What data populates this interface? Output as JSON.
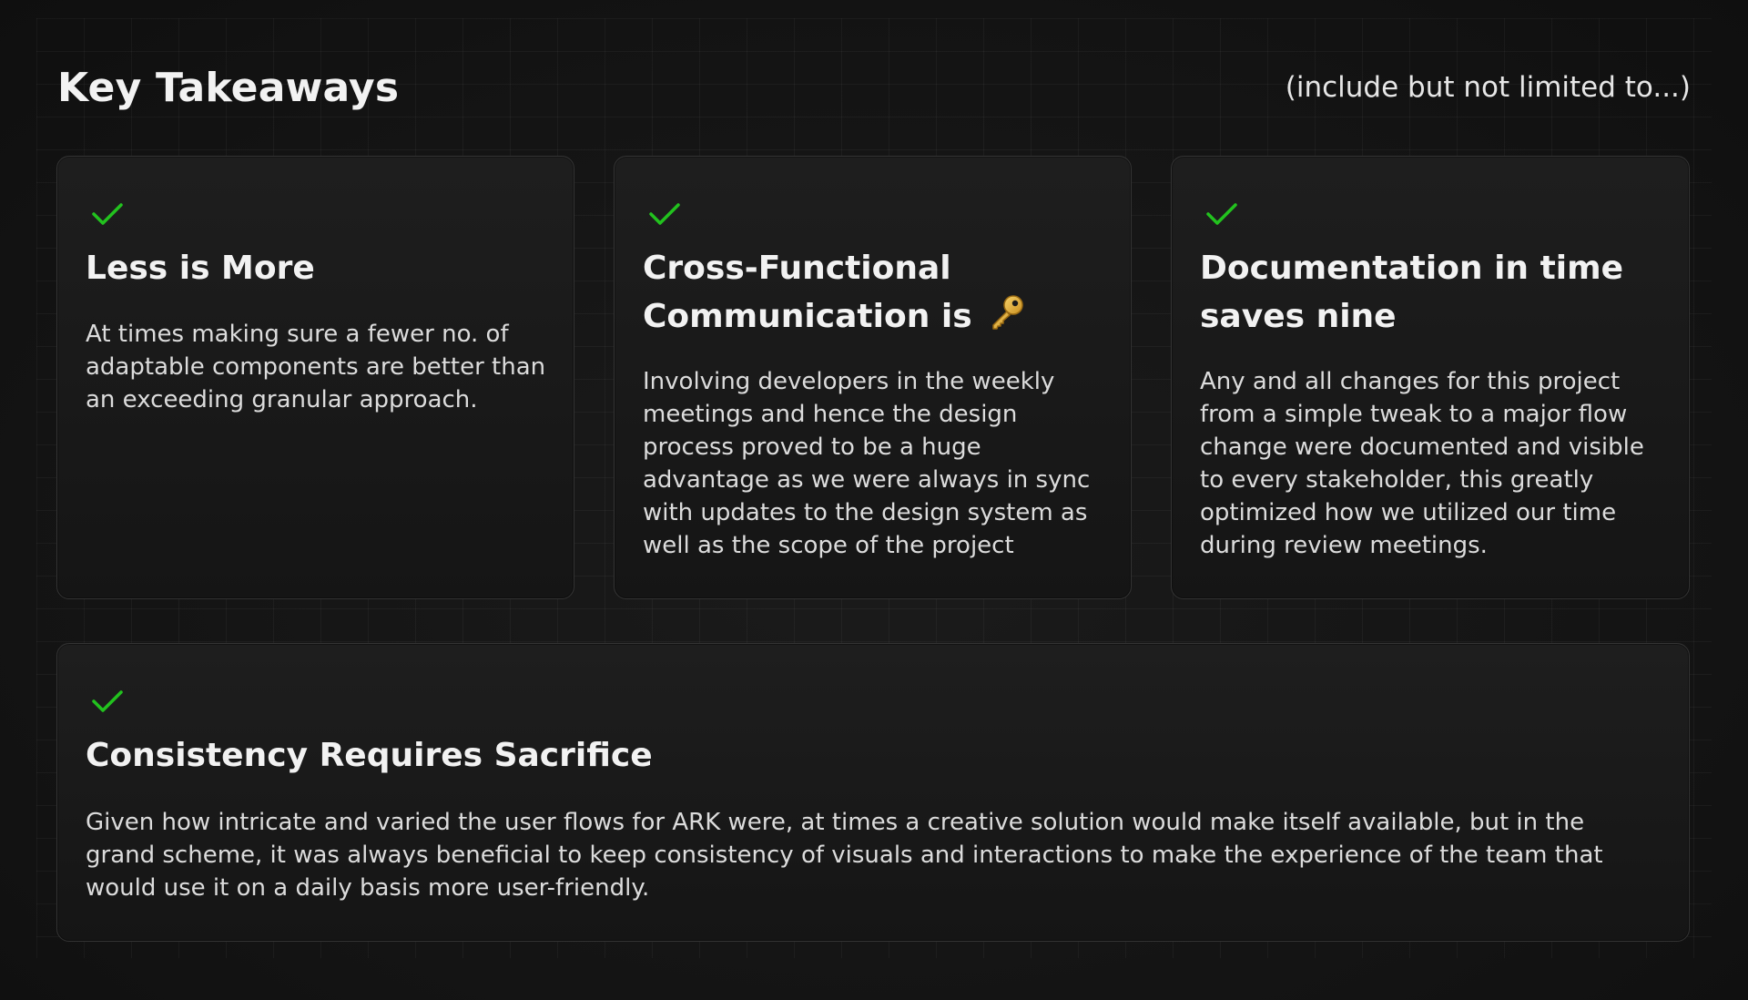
{
  "header": {
    "title": "Key Takeaways",
    "note": "(include but not limited to...)"
  },
  "colors": {
    "accent_check": "#22c21e",
    "background": "#141414",
    "card_border": "#343434"
  },
  "cards": [
    {
      "icon": "check-icon",
      "title": "Less is More",
      "body": "At times making sure a fewer no. of adaptable components are better than an exceeding granular approach."
    },
    {
      "icon": "check-icon",
      "title": "Cross-Functional Communication is",
      "title_icon": "key-icon",
      "body": "Involving developers in the weekly meetings and hence the design process proved to be a huge advantage as we were always in sync with updates to the design system as well as the scope of the project"
    },
    {
      "icon": "check-icon",
      "title": "Documentation in time saves nine",
      "body": "Any and all changes for this project from a simple tweak to a major flow change were documented and visible to every stakeholder, this greatly optimized how we utilized our time during review meetings."
    },
    {
      "icon": "check-icon",
      "title": "Consistency Requires Sacrifice",
      "body": "Given how intricate and varied the user flows for ARK were, at times a creative solution would make itself available, but in the grand scheme, it was always beneficial to keep consistency of visuals and interactions to make the experience of the team that would use it on a daily basis more user-friendly."
    }
  ]
}
